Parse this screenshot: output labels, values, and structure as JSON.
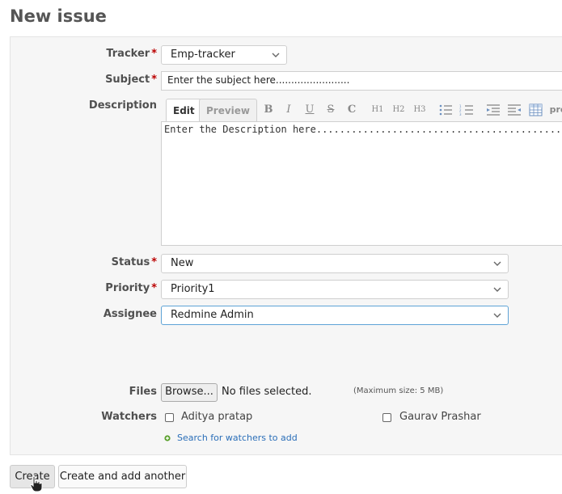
{
  "page": {
    "title": "New issue"
  },
  "form": {
    "required_mark": "*",
    "tracker": {
      "label": "Tracker",
      "value": "Emp-tracker"
    },
    "subject": {
      "label": "Subject",
      "value": "Enter the subject here........................"
    },
    "description": {
      "label": "Description",
      "tabs": {
        "edit": "Edit",
        "preview": "Preview"
      },
      "toolbar": {
        "bold": "B",
        "italic": "I",
        "underline": "U",
        "strike": "S",
        "code": "C",
        "h1": "H1",
        "h2": "H2",
        "h3": "H3",
        "pre": "pre"
      },
      "value": "Enter the Description here............................................"
    },
    "status": {
      "label": "Status",
      "value": "New"
    },
    "priority": {
      "label": "Priority",
      "value": "Priority1"
    },
    "assignee": {
      "label": "Assignee",
      "value": "Redmine Admin"
    },
    "files": {
      "label": "Files",
      "browse_label": "Browse...",
      "status": "No files selected.",
      "max_size": "(Maximum size: 5 MB)"
    },
    "watchers": {
      "label": "Watchers",
      "people": [
        "Aditya pratap",
        "Gaurav Prashar"
      ],
      "search_link": "Search for watchers to add"
    }
  },
  "actions": {
    "create": "Create",
    "create_another": "Create and add another"
  },
  "colors": {
    "required": "#bb0000",
    "link": "#2a6eb8",
    "focus_border": "#5ea3d6",
    "title": "#555555"
  }
}
